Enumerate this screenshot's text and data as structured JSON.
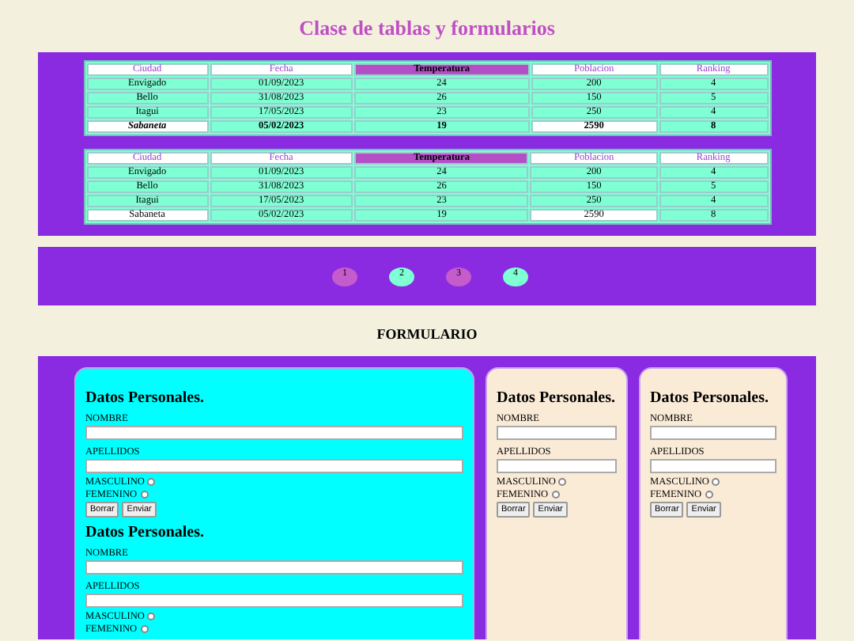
{
  "title": "Clase de tablas y formularios",
  "tables": [
    {
      "columns": [
        {
          "label": "Ciudad",
          "highlighted": false
        },
        {
          "label": "Fecha",
          "highlighted": false
        },
        {
          "label": "Temperatura",
          "highlighted": true
        },
        {
          "label": "Poblacion",
          "highlighted": false
        },
        {
          "label": "Ranking",
          "highlighted": false
        }
      ],
      "rows": [
        {
          "kind": "normal",
          "cells": [
            {
              "text": "Envigado",
              "highlighted": false
            },
            {
              "text": "01/09/2023",
              "highlighted": false
            },
            {
              "text": "24",
              "highlighted": false
            },
            {
              "text": "200",
              "highlighted": false
            },
            {
              "text": "4",
              "highlighted": false
            }
          ]
        },
        {
          "kind": "normal",
          "cells": [
            {
              "text": "Bello",
              "highlighted": false
            },
            {
              "text": "31/08/2023",
              "highlighted": false
            },
            {
              "text": "26",
              "highlighted": false
            },
            {
              "text": "150",
              "highlighted": false
            },
            {
              "text": "5",
              "highlighted": false
            }
          ]
        },
        {
          "kind": "normal",
          "cells": [
            {
              "text": "Itagui",
              "highlighted": false
            },
            {
              "text": "17/05/2023",
              "highlighted": false
            },
            {
              "text": "23",
              "highlighted": false
            },
            {
              "text": "250",
              "highlighted": false
            },
            {
              "text": "4",
              "highlighted": false
            }
          ]
        },
        {
          "kind": "summary",
          "cells": [
            {
              "text": "Sabaneta",
              "highlighted": true
            },
            {
              "text": "05/02/2023",
              "highlighted": false
            },
            {
              "text": "19",
              "highlighted": false
            },
            {
              "text": "2590",
              "highlighted": true
            },
            {
              "text": "8",
              "highlighted": false
            }
          ]
        }
      ]
    },
    {
      "columns": [
        {
          "label": "Ciudad",
          "highlighted": false
        },
        {
          "label": "Fecha",
          "highlighted": false
        },
        {
          "label": "Temperatura",
          "highlighted": true
        },
        {
          "label": "Poblacion",
          "highlighted": false
        },
        {
          "label": "Ranking",
          "highlighted": false
        }
      ],
      "rows": [
        {
          "kind": "normal",
          "cells": [
            {
              "text": "Envigado",
              "highlighted": false
            },
            {
              "text": "01/09/2023",
              "highlighted": false
            },
            {
              "text": "24",
              "highlighted": false
            },
            {
              "text": "200",
              "highlighted": false
            },
            {
              "text": "4",
              "highlighted": false
            }
          ]
        },
        {
          "kind": "normal",
          "cells": [
            {
              "text": "Bello",
              "highlighted": false
            },
            {
              "text": "31/08/2023",
              "highlighted": false
            },
            {
              "text": "26",
              "highlighted": false
            },
            {
              "text": "150",
              "highlighted": false
            },
            {
              "text": "5",
              "highlighted": false
            }
          ]
        },
        {
          "kind": "normal",
          "cells": [
            {
              "text": "Itagui",
              "highlighted": false
            },
            {
              "text": "17/05/2023",
              "highlighted": false
            },
            {
              "text": "23",
              "highlighted": false
            },
            {
              "text": "250",
              "highlighted": false
            },
            {
              "text": "4",
              "highlighted": false
            }
          ]
        },
        {
          "kind": "normal",
          "cells": [
            {
              "text": "Sabaneta",
              "highlighted": true
            },
            {
              "text": "05/02/2023",
              "highlighted": false
            },
            {
              "text": "19",
              "highlighted": false
            },
            {
              "text": "2590",
              "highlighted": true
            },
            {
              "text": "8",
              "highlighted": false
            }
          ]
        }
      ]
    }
  ],
  "pagination": [
    {
      "label": "1",
      "color": "#c45ccc"
    },
    {
      "label": "2",
      "color": "#7fffd4"
    },
    {
      "label": "3",
      "color": "#c45ccc"
    },
    {
      "label": "4",
      "color": "#7fffd4"
    }
  ],
  "section_title": "FORMULARIO",
  "cards": [
    {
      "color": "#00ffff",
      "forms": [
        {
          "heading": "Datos Personales.",
          "fields": [
            {
              "label": "NOMBRE"
            },
            {
              "label": "APELLIDOS"
            }
          ],
          "radios": [
            {
              "label": "MASCULINO",
              "checked": false
            },
            {
              "label": "FEMENINO",
              "checked": false
            }
          ],
          "buttons": [
            "Borrar",
            "Enviar"
          ]
        },
        {
          "heading": "Datos Personales.",
          "fields": [
            {
              "label": "NOMBRE"
            },
            {
              "label": "APELLIDOS"
            }
          ],
          "radios": [
            {
              "label": "MASCULINO",
              "checked": false
            },
            {
              "label": "FEMENINO",
              "checked": false
            }
          ]
        }
      ]
    },
    {
      "color": "#faebd7",
      "forms": [
        {
          "heading": "Datos Personales.",
          "fields": [
            {
              "label": "NOMBRE"
            },
            {
              "label": "APELLIDOS"
            }
          ],
          "radios": [
            {
              "label": "MASCULINO",
              "checked": false
            },
            {
              "label": "FEMENINO",
              "checked": false
            }
          ],
          "buttons": [
            "Borrar",
            "Enviar"
          ]
        }
      ]
    },
    {
      "color": "#faebd7",
      "forms": [
        {
          "heading": "Datos Personales.",
          "fields": [
            {
              "label": "NOMBRE"
            },
            {
              "label": "APELLIDOS"
            }
          ],
          "radios": [
            {
              "label": "MASCULINO",
              "checked": false
            },
            {
              "label": "FEMENINO",
              "checked": false
            }
          ],
          "buttons": [
            "Borrar",
            "Enviar"
          ]
        }
      ]
    }
  ]
}
